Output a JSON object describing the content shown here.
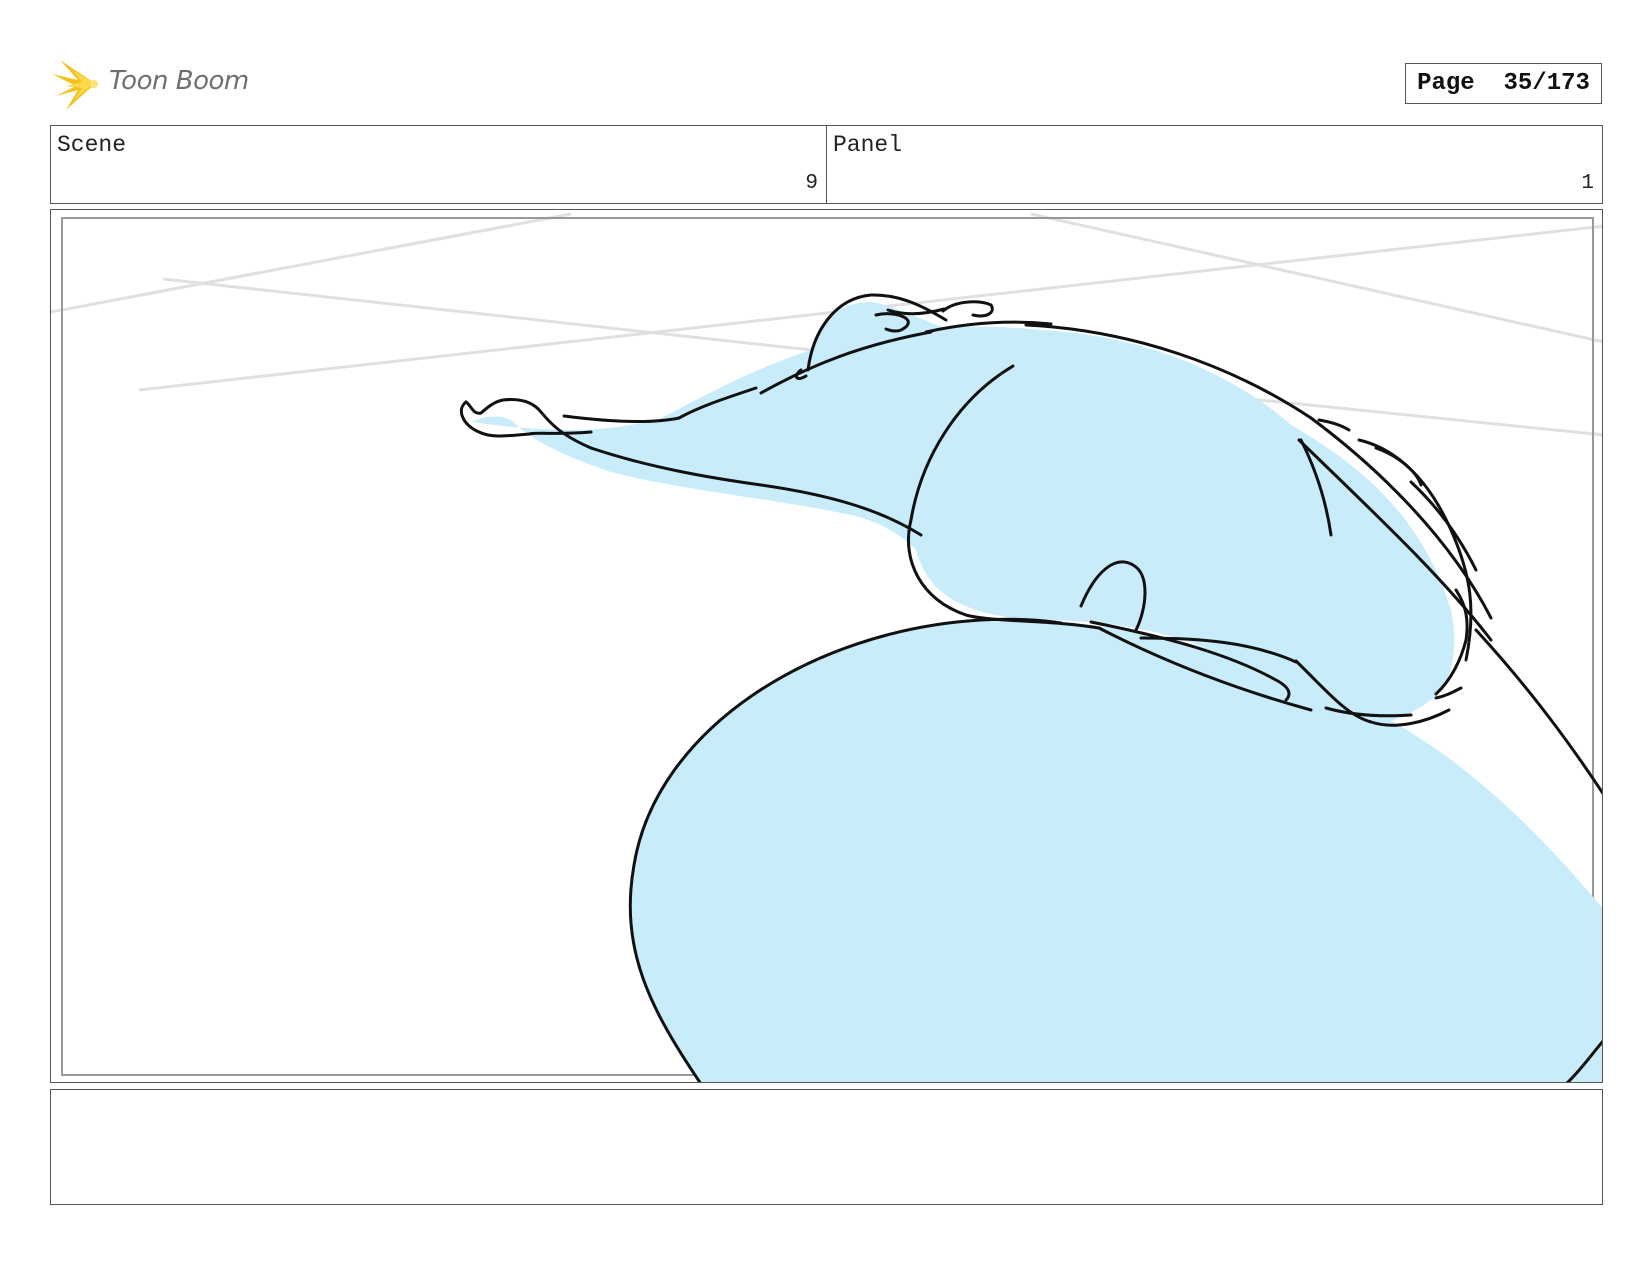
{
  "header": {
    "brand": "Toon Boom",
    "page_label": "Page",
    "page_number": "35/173"
  },
  "info": {
    "scene_label": "Scene",
    "scene_value": "9",
    "panel_label": "Panel",
    "panel_value": "1"
  },
  "drawing": {
    "fill_color": "#c9ecfb",
    "line_color": "#111111",
    "guide_color": "#e0e0e0"
  },
  "notes": {
    "text": ""
  }
}
